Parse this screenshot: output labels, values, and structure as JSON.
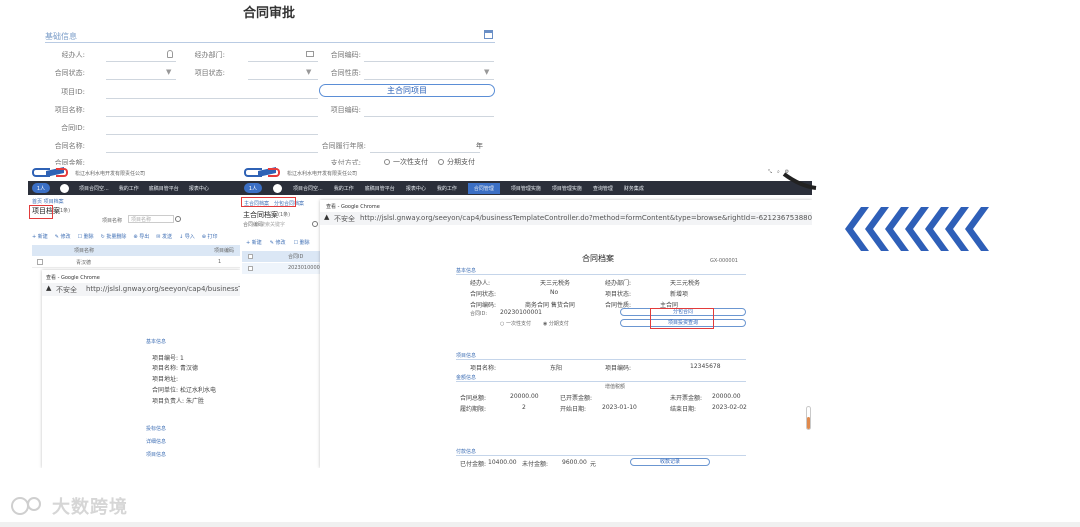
{
  "top_form": {
    "title": "合同审批",
    "section": "基础信息",
    "labels": {
      "handler": "经办人:",
      "dept": "经办部门:",
      "contract_no": "合同编码:",
      "status": "合同状态:",
      "project_status": "项目状态:",
      "nature": "合同性质:",
      "project_id": "项目ID:",
      "project_name": "项目名称:",
      "project_code": "项目编码:",
      "contract_id": "合同ID:",
      "contract_name": "合同名称:",
      "term": "合同履行年限:",
      "term_unit": "年",
      "contract_amount": "合同金额:",
      "pay_method": "支付方式:"
    },
    "main_project_btn": "主合同项目",
    "radio_once": "一次性支付",
    "radio_stage": "分期支付"
  },
  "left_window": {
    "company": "松辽水利水电开发有限责任公司",
    "user": "1人",
    "nav": [
      "项目合同空...",
      "我的工作",
      "底稿目管平台",
      "报表中心"
    ],
    "breadcrumb": "首页  项目档案",
    "page_title": "项目档案",
    "count": "(1条)",
    "search_label": "项目名称",
    "search_placeholder": "项目名称",
    "toolbar": [
      "+ 新建",
      "✎ 修改",
      "☐ 删除",
      "↻ 批量删除",
      "⊕ 导出",
      "✉ 发送",
      "↓ 导入",
      "⊕ 打印"
    ],
    "table_header": [
      "项目名称",
      "项目编码"
    ],
    "table_rows": [
      [
        "青汉德",
        "1"
      ]
    ],
    "chrome_title": "查看 - Google Chrome",
    "url_prefix": "不安全",
    "url": "http://jslsl.gnway.org/seeyon/cap4/businessTemplateC",
    "detail_sections": [
      "基本信息",
      "投标信息",
      "详细信息",
      "项目信息"
    ],
    "detail_rows": [
      [
        "项目编号:",
        "1"
      ],
      [
        "项目名称:",
        "青汉德"
      ],
      [
        "项目地址:",
        ""
      ],
      [
        "合同单位:",
        "松辽水利水电"
      ],
      [
        "项目负责人:",
        "朱广胜"
      ]
    ]
  },
  "right_window": {
    "company": "松辽水利水电开发有限责任公司",
    "user": "1人",
    "nav": [
      "项目合同空...",
      "我的工作",
      "底稿目管平台",
      "报表中心",
      "我的工作",
      "合同管理",
      "项目管理实施",
      "项目管理实施",
      "查询管理",
      "财务集成"
    ],
    "tabs": [
      "主合同档案",
      "分包合同档案"
    ],
    "page_title": "主合同档案",
    "count": "(1条)",
    "search_label": "合同编码",
    "search_placeholder": "搜索关键字",
    "toolbar": [
      "+ 新建",
      "✎ 修改",
      "☐ 删除"
    ],
    "table_header": [
      "合同ID"
    ],
    "table_rows": [
      [
        "20230100001"
      ]
    ],
    "chrome_title": "查看 - Google Chrome",
    "url_prefix": "不安全",
    "url": "http://jslsl.gnway.org/seeyon/cap4/businessTemplateController.do?method=formContent&type=browse&rightId=-6212367538805781357.-8665261",
    "doc_title": "合同档案",
    "doc_no": "GX-000001",
    "sections": [
      "基本信息",
      "项目信息",
      "金额信息",
      "付款信息"
    ],
    "basic_rows": [
      [
        "经办人:",
        "天三元税务",
        "经办部门:",
        "天三元税务"
      ],
      [
        "合同状态:",
        "No",
        "项目状态:",
        "新增项"
      ],
      [
        "合同编码:",
        "商务合同 售货合同",
        "合同性质:",
        "主合同"
      ],
      [
        "合同ID:",
        "20230100001",
        "",
        ""
      ]
    ],
    "radio_once": "一次性支付",
    "radio_stage": "分期支付",
    "btn_sub": "分包合同",
    "btn_proj": "项目投资查询",
    "proj_rows": [
      [
        "项目名称:",
        "东阳",
        "项目编码:",
        "12345678"
      ]
    ],
    "amount_head": "增值税额",
    "amount_rows": [
      [
        "合同总额:",
        "20000.00",
        "已开票金额:",
        "",
        "未开票金额:",
        "20000.00"
      ],
      [
        "履约期限:",
        "2",
        "开始日期:",
        "2023-01-10",
        "结束日期:",
        "2023-02-02"
      ]
    ],
    "pay_rows": [
      [
        "已付金额:",
        "10400.00",
        "未付金额:",
        "9600.00",
        "元"
      ]
    ],
    "pay_btn": "收款记录"
  },
  "watermark": "大数跨境",
  "colors": {
    "accent_blue": "#2b62b8",
    "nav_dark": "#2b2f3a",
    "highlight_red": "#e23b3b",
    "chevron_blue": "#2e5fb8"
  }
}
